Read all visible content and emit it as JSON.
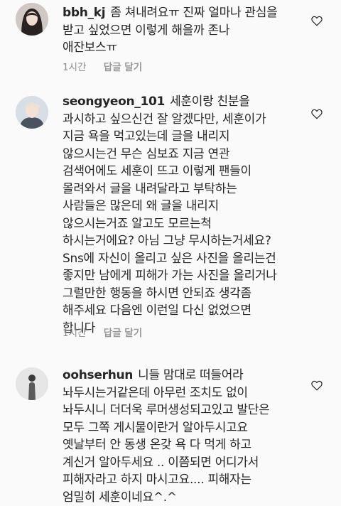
{
  "comments": [
    {
      "username": "bbh_kj",
      "lines": [
        "좀 쳐내려요ㅠ 진짜 얼마나 관심을",
        "받고 싶었으면 이렇게 해을까 존나",
        "애잔보스ㅠ"
      ],
      "time": "1시간",
      "reply_label": "답글 달기"
    },
    {
      "username": "seongyeon_101",
      "lines": [
        "세훈이랑 친분을",
        "과시하고 싶으신건 잘 알겠다만, 세훈이가",
        "지금 욕을 먹고있는데 글을 내리지",
        "않으시는건 무슨 심보죠 지금 연관",
        "검색어에도 세훈이 뜨고 이렇게 팬들이",
        "몰려와서 글을 내려달라고 부탁하는",
        "사람들은 많은데 왜 글을 내리지",
        "않으시는거죠 알고도 모르는척",
        "하시는거에요? 아님 그냥 무시하는거세요?",
        "Sns에 자신이 올리고 싶은 사진을 올리는건",
        "좋지만 남에게 피해가 가는 사진을 올리거나",
        "그럴만한 행동을 하시면 안되죠 생각좀",
        "해주세요 다음엔 이런일 다신 없었으면",
        "합니다"
      ],
      "time": "1시간",
      "reply_label": "답글 달기"
    },
    {
      "username": "oohserhun",
      "lines": [
        "니들 맘대로 떠들어라",
        "놔두시는거같은데 아무런 조치도 없이",
        "놔두시니 더더욱 루머생성되고있고 발단은",
        "모두 그쪽 게시물이란거 알아두시고요",
        "옛날부터 안 동생 온갖 욕 다 먹게 하고",
        "계신거 알아두세요 .. 이쯤되면 어디가서",
        "피해자라고 하지 마시고요.... 피해자는",
        "엄밀히 세훈이네요^.^"
      ]
    }
  ]
}
